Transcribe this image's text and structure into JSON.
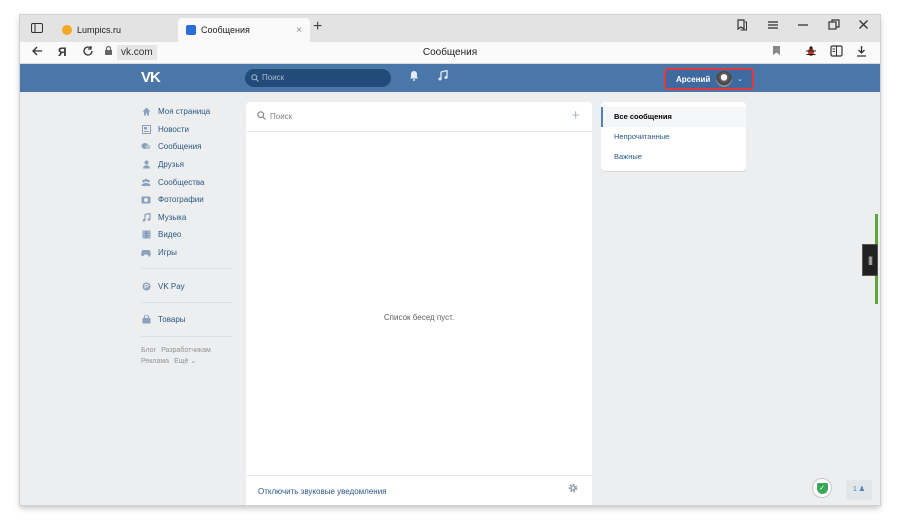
{
  "browser": {
    "tabs": [
      {
        "label": "Lumpics.ru",
        "active": false
      },
      {
        "label": "Сообщения",
        "active": true
      }
    ],
    "tab_close": "×",
    "new_tab": "+",
    "address": "vk.com",
    "page_title": "Сообщения",
    "icons": {
      "sidebar": "sidebar-icon",
      "back": "back-arrow-icon",
      "yandex": "Я",
      "reload": "reload-icon",
      "lock": "lock-icon",
      "bookmark": "bookmark-icon",
      "extension": "bug-extension-icon",
      "reader": "reader-icon",
      "download": "download-icon",
      "collections": "collections-icon",
      "menu": "hamburger-menu-icon",
      "minimize": "minimize-icon",
      "restore": "restore-icon",
      "close": "close-icon"
    }
  },
  "vk_header": {
    "logo": "VK",
    "search_placeholder": "Поиск",
    "user_name": "Арсений",
    "accent_color": "#4a76a8",
    "highlight_color": "#e0393e"
  },
  "left_menu": {
    "items": [
      {
        "label": "Моя страница",
        "icon": "home-icon"
      },
      {
        "label": "Новости",
        "icon": "news-icon"
      },
      {
        "label": "Сообщения",
        "icon": "messages-icon"
      },
      {
        "label": "Друзья",
        "icon": "friends-icon"
      },
      {
        "label": "Сообщества",
        "icon": "communities-icon"
      },
      {
        "label": "Фотографии",
        "icon": "photos-icon"
      },
      {
        "label": "Музыка",
        "icon": "music-icon"
      },
      {
        "label": "Видео",
        "icon": "video-icon"
      },
      {
        "label": "Игры",
        "icon": "games-icon"
      }
    ],
    "pay": {
      "label": "VK Pay",
      "icon": "vkpay-icon"
    },
    "goods": {
      "label": "Товары",
      "icon": "goods-icon"
    },
    "footer": {
      "blog": "Блог",
      "developers": "Разработчикам",
      "ads": "Реклама",
      "more": "Ещё ⌄"
    }
  },
  "conversations": {
    "search_placeholder": "Поиск",
    "empty_text": "Список бесед пуст.",
    "mute_link": "Отключить звуковые уведомления"
  },
  "filters": {
    "items": [
      {
        "label": "Все сообщения",
        "active": true
      },
      {
        "label": "Непрочитанные",
        "active": false
      },
      {
        "label": "Важные",
        "active": false
      }
    ]
  },
  "widgets": {
    "counter_label": "1 ♟"
  }
}
